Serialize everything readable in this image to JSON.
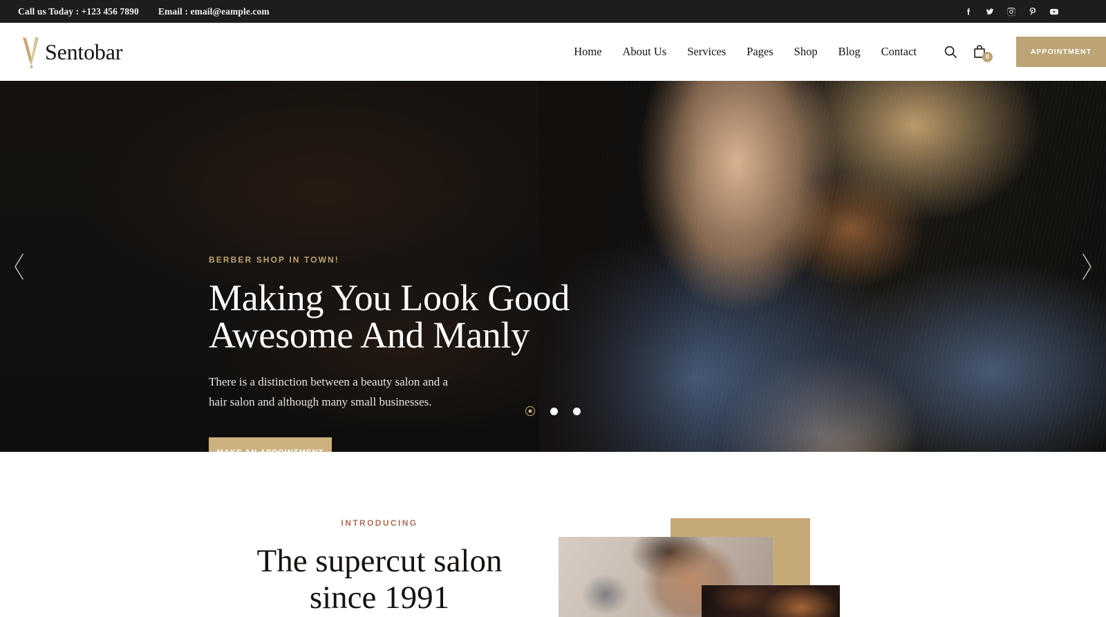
{
  "topbar": {
    "phone_label": "Call us Today : +123 456 7890",
    "email_label": "Email : email@eample.com",
    "socials": [
      {
        "name": "facebook-icon",
        "label": "Facebook"
      },
      {
        "name": "twitter-icon",
        "label": "Twitter"
      },
      {
        "name": "instagram-icon",
        "label": "Instagram"
      },
      {
        "name": "pinterest-icon",
        "label": "Pinterest"
      },
      {
        "name": "youtube-icon",
        "label": "YouTube"
      }
    ]
  },
  "header": {
    "brand": "Sentobar",
    "nav": [
      {
        "label": "Home"
      },
      {
        "label": "About Us"
      },
      {
        "label": "Services"
      },
      {
        "label": "Pages"
      },
      {
        "label": "Shop"
      },
      {
        "label": "Blog"
      },
      {
        "label": "Contact"
      }
    ],
    "search_icon": "search-icon",
    "cart_icon": "shopping-bag-icon",
    "cart_count": "0",
    "appointment_label": "APPOINTMENT"
  },
  "hero": {
    "eyebrow": "BERBER SHOP IN TOWN!",
    "title_line1": "Making You Look Good",
    "title_line2": "Awesome And Manly",
    "paragraph": "There is a distinction between a beauty salon and a hair salon and although many small businesses.",
    "cta_label": "MAKE AN APPOINTMENT",
    "prev_icon": "chevron-left-icon",
    "next_icon": "chevron-right-icon",
    "slides": [
      {
        "index": "1",
        "active": true
      },
      {
        "index": "2",
        "active": false
      },
      {
        "index": "3",
        "active": false
      }
    ]
  },
  "intro": {
    "eyebrow": "INTRODUCING",
    "title_line1": "The supercut salon",
    "title_line2": "since 1991"
  },
  "colors": {
    "gold": "#bca476",
    "gold_light": "#cdb181",
    "gold_block": "#c5aa78",
    "terracotta": "#a9715b",
    "dark": "#1d1d1d",
    "ink": "#16120f"
  }
}
